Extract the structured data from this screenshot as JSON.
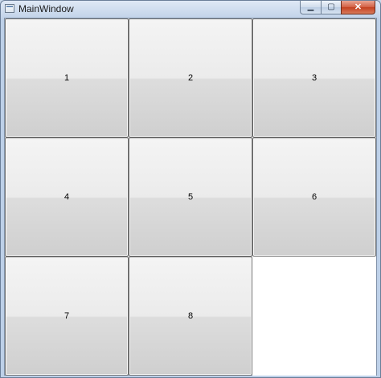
{
  "window": {
    "title": "MainWindow",
    "caption": {
      "minimize_glyph": "▁",
      "maximize_glyph": "▢",
      "close_glyph": "✕"
    }
  },
  "puzzle": {
    "tiles": [
      {
        "label": "1"
      },
      {
        "label": "2"
      },
      {
        "label": "3"
      },
      {
        "label": "4"
      },
      {
        "label": "5"
      },
      {
        "label": "6"
      },
      {
        "label": "7"
      },
      {
        "label": "8"
      }
    ]
  },
  "colors": {
    "tile_border": "#707070",
    "window_frame": "#c4d5ea",
    "close_button": "#c2401f"
  }
}
